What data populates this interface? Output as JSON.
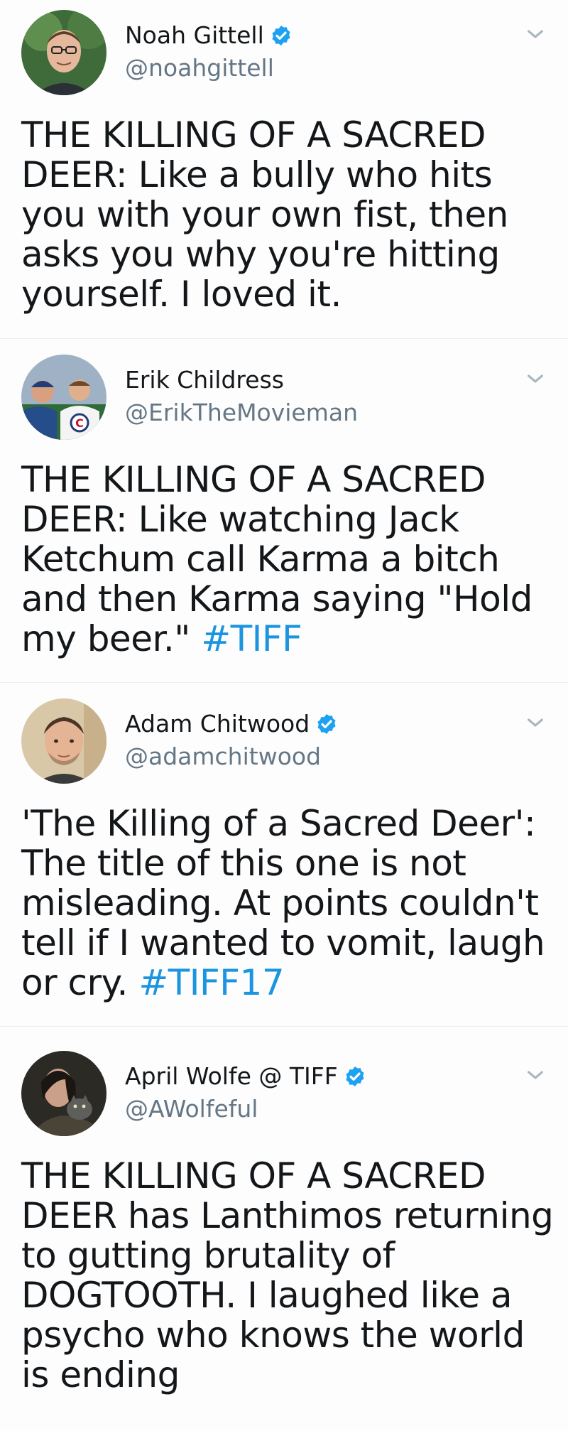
{
  "colors": {
    "text": "#14171a",
    "handle": "#657786",
    "link": "#1b95e0",
    "verified": "#1da1f2",
    "chevron": "#aab8c2"
  },
  "tweets": [
    {
      "display_name": "Noah Gittell",
      "handle": "@noahgittell",
      "verified": true,
      "text": "THE KILLING OF A SACRED DEER: Like a bully who hits you with your own fist, then asks you why you're hitting yourself. I loved it.",
      "hashtag": ""
    },
    {
      "display_name": "Erik Childress",
      "handle": "@ErikTheMovieman",
      "verified": false,
      "text": "THE KILLING OF A SACRED DEER: Like watching Jack Ketchum call Karma a bitch and then Karma saying \"Hold my beer.\" ",
      "hashtag": "#TIFF"
    },
    {
      "display_name": "Adam Chitwood",
      "handle": "@adamchitwood",
      "verified": true,
      "text": "'The Killing of a Sacred Deer': The title of this one is not misleading. At points couldn't tell if I wanted to vomit, laugh or cry. ",
      "hashtag": "#TIFF17"
    },
    {
      "display_name": "April Wolfe @ TIFF",
      "handle": "@AWolfeful",
      "verified": true,
      "text": "THE KILLING OF A SACRED DEER has Lanthimos returning to gutting brutality of DOGTOOTH. I laughed like a psycho who knows the world is ending",
      "hashtag": ""
    }
  ]
}
